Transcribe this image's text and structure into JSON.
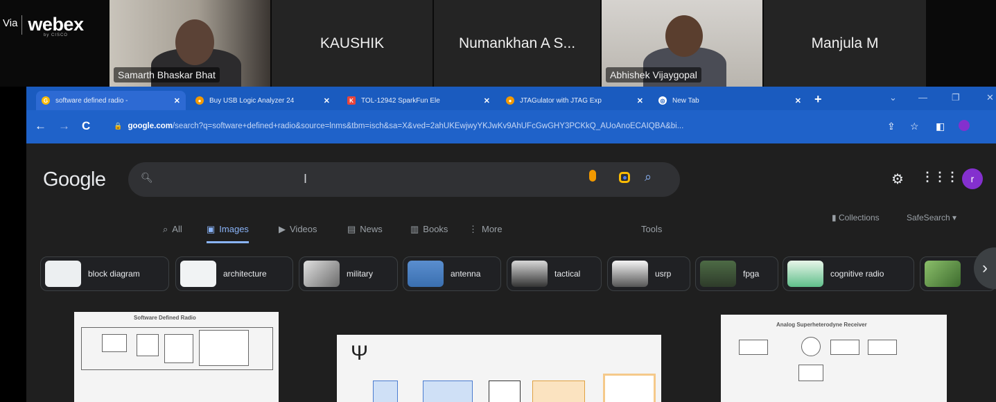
{
  "webex": {
    "via": "Via",
    "logo": "webex",
    "logo_sub": "by CISCO",
    "participants": [
      {
        "name": "Samarth Bhaskar Bhat",
        "video": true
      },
      {
        "name": "KAUSHIK",
        "video": false
      },
      {
        "name": "Numankhan A S...",
        "video": false
      },
      {
        "name": "Abhishek Vijaygopal",
        "video": true
      },
      {
        "name": "Manjula M",
        "video": false
      }
    ]
  },
  "browser": {
    "tabs": [
      {
        "title": "software defined radio - ",
        "favicon": "google-icon",
        "color": "#fbbc04",
        "active": true
      },
      {
        "title": "Buy USB Logic Analyzer 24",
        "favicon": "store-icon",
        "color": "#f29900"
      },
      {
        "title": "TOL-12942 SparkFun Ele",
        "favicon": "sparkfun-icon",
        "color": "#e8453c"
      },
      {
        "title": "JTAGulator with JTAG Exp",
        "favicon": "store-icon",
        "color": "#f29900"
      },
      {
        "title": "New Tab",
        "favicon": "chrome-icon",
        "color": "#ffffff"
      }
    ],
    "url_host": "google.com",
    "url_rest": "/search?q=software+defined+radio&source=lnms&tbm=isch&sa=X&ved=2ahUKEwjwyYKJwKv9AhUFcGwGHY3PCKkQ_AUoAnoECAIQBA&bi..."
  },
  "google": {
    "logo": "Google",
    "search_placeholder": "",
    "avatar_letter": "r",
    "nav_tabs": [
      {
        "label": "All",
        "icon": "search-icon"
      },
      {
        "label": "Images",
        "icon": "image-icon",
        "active": true
      },
      {
        "label": "Videos",
        "icon": "video-icon"
      },
      {
        "label": "News",
        "icon": "news-icon"
      },
      {
        "label": "Books",
        "icon": "book-icon"
      },
      {
        "label": "More",
        "icon": "more-icon"
      }
    ],
    "tools": "Tools",
    "collections": "Collections",
    "safesearch": "SafeSearch",
    "chips": [
      "block diagram",
      "architecture",
      "military",
      "antenna",
      "tactical",
      "usrp",
      "fpga",
      "cognitive radio"
    ],
    "result1_title": "Software Defined Radio",
    "result3_title": "Analog Superheterodyne Receiver"
  }
}
